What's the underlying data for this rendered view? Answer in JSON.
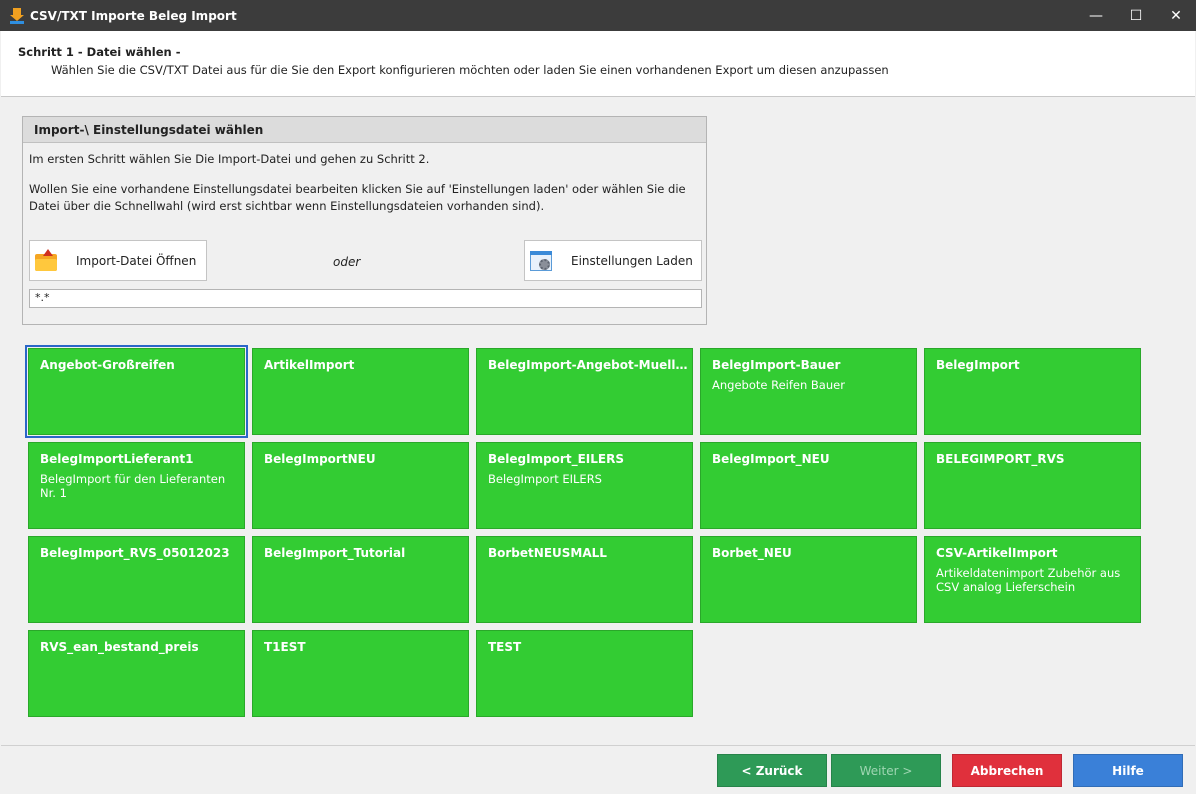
{
  "window": {
    "title": "CSV/TXT Importe Beleg Import",
    "controls": {
      "minimize": "—",
      "maximize": "☐",
      "close": "✕"
    }
  },
  "header": {
    "step_title": "Schritt 1 - Datei wählen -",
    "step_desc": "Wählen Sie die CSV/TXT Datei aus für die Sie den Export konfigurieren möchten oder laden Sie einen vorhandenen Export um diesen anzupassen"
  },
  "panel": {
    "title": "Import-\\ Einstellungsdatei wählen",
    "line1": "Im ersten Schritt wählen Sie Die Import-Datei und gehen zu Schritt 2.",
    "line2": "Wollen Sie eine vorhandene Einstellungsdatei bearbeiten klicken Sie auf 'Einstellungen laden' oder wählen Sie die Datei über die Schnellwahl (wird erst sichtbar wenn Einstellungsdateien vorhanden sind).",
    "open_button": "Import-Datei Öffnen",
    "or_label": "oder",
    "load_button": "Einstellungen Laden",
    "filter_value": "*.*"
  },
  "tiles": [
    {
      "name": "Angebot-Großreifen",
      "desc": ""
    },
    {
      "name": "ArtikelImport",
      "desc": ""
    },
    {
      "name": "BelegImport-Angebot-Muell...",
      "desc": ""
    },
    {
      "name": "BelegImport-Bauer",
      "desc": "Angebote Reifen Bauer"
    },
    {
      "name": "BelegImport",
      "desc": ""
    },
    {
      "name": "BelegImportLieferant1",
      "desc": "BelegImport für den Lieferanten Nr. 1"
    },
    {
      "name": "BelegImportNEU",
      "desc": ""
    },
    {
      "name": "BelegImport_EILERS",
      "desc": "BelegImport EILERS"
    },
    {
      "name": "BelegImport_NEU",
      "desc": ""
    },
    {
      "name": "BELEGIMPORT_RVS",
      "desc": ""
    },
    {
      "name": "BelegImport_RVS_05012023",
      "desc": ""
    },
    {
      "name": "BelegImport_Tutorial",
      "desc": ""
    },
    {
      "name": "BorbetNEUSMALL",
      "desc": ""
    },
    {
      "name": "Borbet_NEU",
      "desc": ""
    },
    {
      "name": "CSV-ArtikelImport",
      "desc": "Artikeldatenimport Zubehör aus CSV analog Lieferschein"
    },
    {
      "name": "RVS_ean_bestand_preis",
      "desc": ""
    },
    {
      "name": "T1EST",
      "desc": ""
    },
    {
      "name": "TEST",
      "desc": ""
    }
  ],
  "footer": {
    "back_label": "< Zurück",
    "next_label": "Weiter >",
    "cancel_label": "Abbrechen",
    "help_label": "Hilfe"
  },
  "colors": {
    "tile": "#33cc33",
    "back": "#2e9a57",
    "cancel": "#e0303c",
    "help": "#3a80d8",
    "selection": "#2a66c8"
  }
}
